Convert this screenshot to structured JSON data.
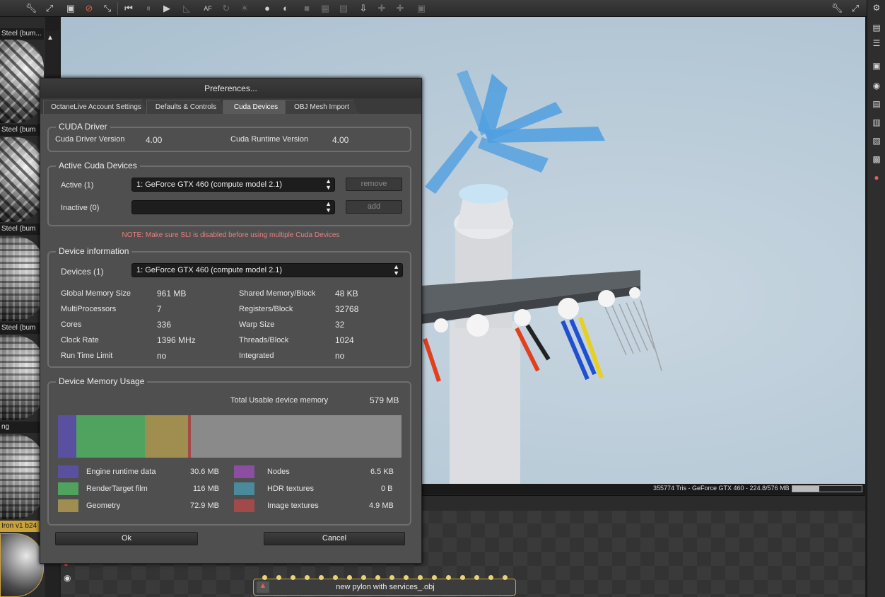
{
  "colors": {
    "engine_runtime": "#5a50a0",
    "render_target": "#4fa35e",
    "geometry": "#a08e50",
    "nodes": "#8a4fa0",
    "hdr_textures": "#4a8a9a",
    "image_textures": "#a24a4a",
    "free": "#8a8a8a",
    "note": "#e68080"
  },
  "materials": [
    {
      "label": "Steel (bum..."
    },
    {
      "label": "Steel (bum"
    },
    {
      "label": "Steel (bum"
    },
    {
      "label": "Steel (bum"
    },
    {
      "label": "ng"
    },
    {
      "label": "Iron v1 b24"
    }
  ],
  "statusbar": {
    "text": "355774 Tris - GeForce GTX 460 - 224.8/576 MB",
    "progress_fraction": 0.39
  },
  "nodegraph": {
    "node_label": "new pylon with services_.obj"
  },
  "dialog": {
    "title": "Preferences...",
    "tabs": [
      "OctaneLive Account Settings",
      "Defaults & Controls",
      "Cuda Devices",
      "OBJ Mesh Import"
    ],
    "active_tab": "Cuda Devices",
    "cuda_driver": {
      "title": "CUDA Driver",
      "driver_version_label": "Cuda Driver Version",
      "driver_version": "4.00",
      "runtime_version_label": "Cuda Runtime Version",
      "runtime_version": "4.00"
    },
    "active_devices": {
      "title": "Active Cuda Devices",
      "active_label": "Active (1)",
      "active_value": "1: GeForce GTX 460 (compute model 2.1)",
      "remove_label": "remove",
      "inactive_label": "Inactive (0)",
      "inactive_value": "",
      "add_label": "add"
    },
    "note": "NOTE: Make sure SLI is disabled before using multiple Cuda Devices",
    "device_info": {
      "title": "Device information",
      "devices_label": "Devices (1)",
      "devices_value": "1: GeForce GTX 460 (compute model 2.1)",
      "left": [
        {
          "label": "Global Memory Size",
          "value": "961 MB"
        },
        {
          "label": "MultiProcessors",
          "value": "7"
        },
        {
          "label": "Cores",
          "value": "336"
        },
        {
          "label": "Clock Rate",
          "value": "1396 MHz"
        },
        {
          "label": "Run Time Limit",
          "value": "no"
        }
      ],
      "right": [
        {
          "label": "Shared Memory/Block",
          "value": "48 KB"
        },
        {
          "label": "Registers/Block",
          "value": "32768"
        },
        {
          "label": "Warp Size",
          "value": "32"
        },
        {
          "label": "Threads/Block",
          "value": "1024"
        },
        {
          "label": "Integrated",
          "value": "no"
        }
      ]
    },
    "memory": {
      "title": "Device Memory Usage",
      "total_label": "Total Usable device memory",
      "total_value": "579 MB",
      "bar_fractions": {
        "engine_runtime": 0.053,
        "render_target": 0.2,
        "geometry": 0.126,
        "image_textures": 0.0085
      },
      "legend_left": [
        {
          "label": "Engine runtime data",
          "value": "30.6 MB"
        },
        {
          "label": "RenderTarget film",
          "value": "116 MB"
        },
        {
          "label": "Geometry",
          "value": "72.9 MB"
        }
      ],
      "legend_right": [
        {
          "label": "Nodes",
          "value": "6.5 KB"
        },
        {
          "label": "HDR textures",
          "value": "0 B"
        },
        {
          "label": "Image textures",
          "value": "4.9 MB"
        }
      ]
    },
    "ok_label": "Ok",
    "cancel_label": "Cancel"
  }
}
